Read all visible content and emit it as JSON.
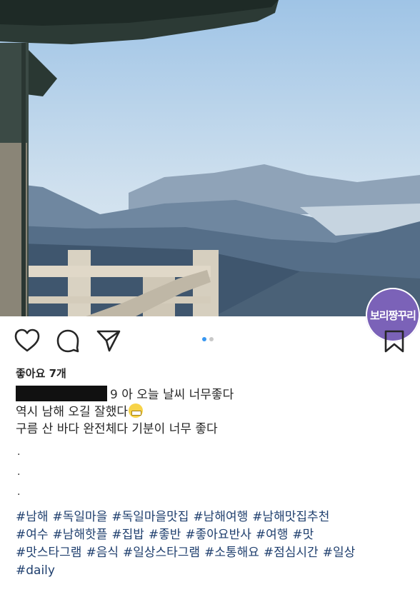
{
  "watermark": {
    "text": "보리짱꾸리"
  },
  "actions": {
    "like_icon": "heart-outline-icon",
    "comment_icon": "comment-bubble-icon",
    "share_icon": "paper-plane-icon",
    "save_icon": "bookmark-icon",
    "carousel": {
      "count": 2,
      "active": 1
    }
  },
  "post": {
    "likes": "좋아요 7개",
    "username_suffix": "9",
    "caption_lines": [
      "아 오늘 날씨 너무좋다",
      "역시 남해 오길 잘했다",
      "구름 산 바다 완전체다 기분이 너무 좋다"
    ],
    "dots": [
      ".",
      ".",
      "."
    ],
    "hashtags": [
      "#남해",
      "#독일마을",
      "#독일마을맛집",
      "#남해여행",
      "#남해맛집추천",
      "#여수",
      "#남해핫플",
      "#집밥",
      "#좋반",
      "#좋아요반사",
      "#여행",
      "#맛",
      "#맛스타그램",
      "#음식",
      "#일상스타그램",
      "#소통해요",
      "#점심시간",
      "#일상",
      "#daily"
    ]
  },
  "colors": {
    "accent": "#3897f0",
    "hashtag": "#1f3f6e",
    "watermark_bg": "#7b62b8"
  }
}
